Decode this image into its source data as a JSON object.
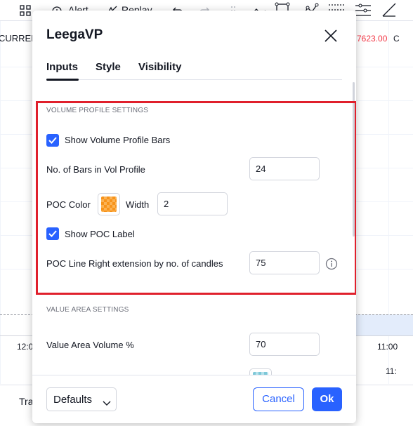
{
  "background": {
    "toolbar": {
      "alert_label": "Alert",
      "replay_label": "Replay"
    },
    "left_label": "CURREN",
    "price_label": "7623.00",
    "price_label_right": "C",
    "time_left": "12:0",
    "time_right": "11:00",
    "time_right2": "11:",
    "bottom_tab": "Tra"
  },
  "dialog": {
    "title": "LeegaVP",
    "tabs": [
      {
        "label": "Inputs",
        "active": true
      },
      {
        "label": "Style",
        "active": false
      },
      {
        "label": "Visibility",
        "active": false
      }
    ],
    "volume_profile_section": {
      "title": "VOLUME PROFILE SETTINGS",
      "show_bars": {
        "label": "Show Volume Profile Bars",
        "checked": true
      },
      "bars_count": {
        "label": "No. of Bars in Vol Profile",
        "value": "24"
      },
      "poc_color": {
        "label": "POC Color",
        "width_label": "Width",
        "width_value": "2",
        "color": "#f7931a"
      },
      "show_poc_label": {
        "label": "Show POC Label",
        "checked": true
      },
      "poc_extension": {
        "label": "POC Line Right extension by no. of candles",
        "value": "75"
      }
    },
    "value_area_section": {
      "title": "VALUE AREA SETTINGS",
      "volume_pct": {
        "label": "Value Area Volume %",
        "value": "70"
      },
      "next_color": "#7ec8d8"
    },
    "footer": {
      "defaults_label": "Defaults",
      "cancel_label": "Cancel",
      "ok_label": "Ok"
    },
    "colors": {
      "accent": "#2962ff",
      "highlight": "#e0202c"
    }
  }
}
